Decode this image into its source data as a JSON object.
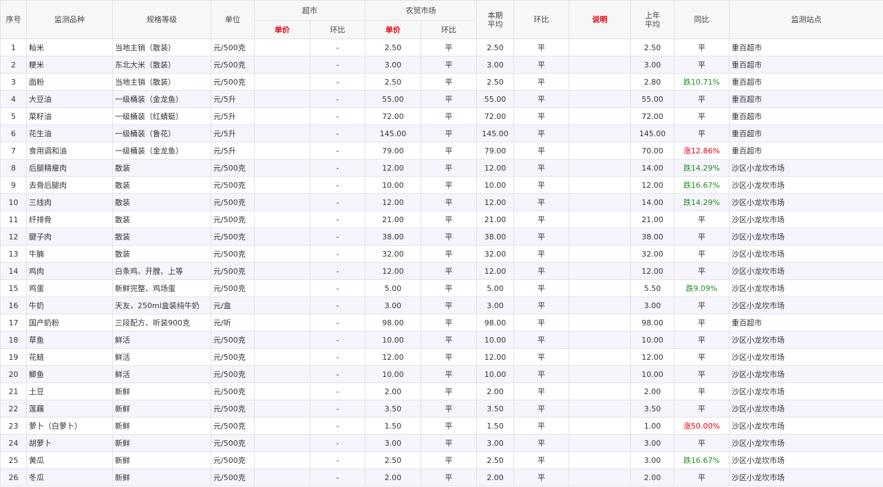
{
  "headers": {
    "seq": "序号",
    "item": "监测品种",
    "spec": "规格等级",
    "unit": "单位",
    "supermarket": "超市",
    "farmers_market": "农贸市场",
    "unit_price": "单价",
    "mom": "环比",
    "current_avg": "本期\n平均",
    "note": "说明",
    "last_year_avg": "上年\n平均",
    "yoy": "同比",
    "station": "监测站点"
  },
  "rows": [
    {
      "no": "1",
      "item": "籼米",
      "spec": "当地主销（散装）",
      "unit": "元/500克",
      "sm_price": "",
      "sm_mom": "-",
      "fm_price": "2.50",
      "fm_mom": "平",
      "avg": "2.50",
      "avg_mom": "平",
      "note": "",
      "last": "2.50",
      "yoy": "平",
      "station": "重百超市"
    },
    {
      "no": "2",
      "item": "粳米",
      "spec": "东北大米（散装）",
      "unit": "元/500克",
      "sm_price": "",
      "sm_mom": "-",
      "fm_price": "3.00",
      "fm_mom": "平",
      "avg": "3.00",
      "avg_mom": "平",
      "note": "",
      "last": "3.00",
      "yoy": "平",
      "station": "重百超市"
    },
    {
      "no": "3",
      "item": "面粉",
      "spec": "当地主销（散装）",
      "unit": "元/500克",
      "sm_price": "",
      "sm_mom": "-",
      "fm_price": "2.50",
      "fm_mom": "平",
      "avg": "2.50",
      "avg_mom": "平",
      "note": "",
      "last": "2.80",
      "yoy": "跌10.71%",
      "station": "重百超市"
    },
    {
      "no": "4",
      "item": "大豆油",
      "spec": "一级桶装（金龙鱼）",
      "unit": "元/5升",
      "sm_price": "",
      "sm_mom": "-",
      "fm_price": "55.00",
      "fm_mom": "平",
      "avg": "55.00",
      "avg_mom": "平",
      "note": "",
      "last": "55.00",
      "yoy": "平",
      "station": "重百超市"
    },
    {
      "no": "5",
      "item": "菜籽油",
      "spec": "一级桶装（红蜻蜓）",
      "unit": "元/5升",
      "sm_price": "",
      "sm_mom": "-",
      "fm_price": "72.00",
      "fm_mom": "平",
      "avg": "72.00",
      "avg_mom": "平",
      "note": "",
      "last": "72.00",
      "yoy": "平",
      "station": "重百超市"
    },
    {
      "no": "6",
      "item": "花生油",
      "spec": "一级桶装（鲁花）",
      "unit": "元/5升",
      "sm_price": "",
      "sm_mom": "-",
      "fm_price": "145.00",
      "fm_mom": "平",
      "avg": "145.00",
      "avg_mom": "平",
      "note": "",
      "last": "145.00",
      "yoy": "平",
      "station": "重百超市"
    },
    {
      "no": "7",
      "item": "食用调和油",
      "spec": "一级桶装（金龙鱼）",
      "unit": "元/5升",
      "sm_price": "",
      "sm_mom": "-",
      "fm_price": "79.00",
      "fm_mom": "平",
      "avg": "79.00",
      "avg_mom": "平",
      "note": "",
      "last": "70.00",
      "yoy": "涨12.86%",
      "station": "重百超市"
    },
    {
      "no": "8",
      "item": "后腿精瘦肉",
      "spec": "散装",
      "unit": "元/500克",
      "sm_price": "",
      "sm_mom": "-",
      "fm_price": "12.00",
      "fm_mom": "平",
      "avg": "12.00",
      "avg_mom": "平",
      "note": "",
      "last": "14.00",
      "yoy": "跌14.29%",
      "station": "沙区小龙坎市场"
    },
    {
      "no": "9",
      "item": "去骨后腿肉",
      "spec": "散装",
      "unit": "元/500克",
      "sm_price": "",
      "sm_mom": "-",
      "fm_price": "10.00",
      "fm_mom": "平",
      "avg": "10.00",
      "avg_mom": "平",
      "note": "",
      "last": "12.00",
      "yoy": "跌16.67%",
      "station": "沙区小龙坎市场"
    },
    {
      "no": "10",
      "item": "三线肉",
      "spec": "散装",
      "unit": "元/500克",
      "sm_price": "",
      "sm_mom": "-",
      "fm_price": "12.00",
      "fm_mom": "平",
      "avg": "12.00",
      "avg_mom": "平",
      "note": "",
      "last": "14.00",
      "yoy": "跌14.29%",
      "station": "沙区小龙坎市场"
    },
    {
      "no": "11",
      "item": "纤排骨",
      "spec": "散装",
      "unit": "元/500克",
      "sm_price": "",
      "sm_mom": "-",
      "fm_price": "21.00",
      "fm_mom": "平",
      "avg": "21.00",
      "avg_mom": "平",
      "note": "",
      "last": "21.00",
      "yoy": "平",
      "station": "沙区小龙坎市场"
    },
    {
      "no": "12",
      "item": "腱子肉",
      "spec": "散装",
      "unit": "元/500克",
      "sm_price": "",
      "sm_mom": "-",
      "fm_price": "38.00",
      "fm_mom": "平",
      "avg": "38.00",
      "avg_mom": "平",
      "note": "",
      "last": "38.00",
      "yoy": "平",
      "station": "沙区小龙坎市场"
    },
    {
      "no": "13",
      "item": "牛腩",
      "spec": "散装",
      "unit": "元/500克",
      "sm_price": "",
      "sm_mom": "-",
      "fm_price": "32.00",
      "fm_mom": "平",
      "avg": "32.00",
      "avg_mom": "平",
      "note": "",
      "last": "32.00",
      "yoy": "平",
      "station": "沙区小龙坎市场"
    },
    {
      "no": "14",
      "item": "鸡肉",
      "spec": "白条鸡、开膛、上等",
      "unit": "元/500克",
      "sm_price": "",
      "sm_mom": "-",
      "fm_price": "12.00",
      "fm_mom": "平",
      "avg": "12.00",
      "avg_mom": "平",
      "note": "",
      "last": "12.00",
      "yoy": "平",
      "station": "沙区小龙坎市场"
    },
    {
      "no": "15",
      "item": "鸡蛋",
      "spec": "新鲜完整、鸡场蛋",
      "unit": "元/500克",
      "sm_price": "",
      "sm_mom": "-",
      "fm_price": "5.00",
      "fm_mom": "平",
      "avg": "5.00",
      "avg_mom": "平",
      "note": "",
      "last": "5.50",
      "yoy": "跌9.09%",
      "station": "沙区小龙坎市场"
    },
    {
      "no": "16",
      "item": "牛奶",
      "spec": "天友，250ml盒装纯牛奶",
      "unit": "元/盒",
      "sm_price": "",
      "sm_mom": "-",
      "fm_price": "3.00",
      "fm_mom": "平",
      "avg": "3.00",
      "avg_mom": "平",
      "note": "",
      "last": "3.00",
      "yoy": "平",
      "station": "沙区小龙坎市场"
    },
    {
      "no": "17",
      "item": "国产奶粉",
      "spec": "三段配方、听装900克",
      "unit": "元/听",
      "sm_price": "",
      "sm_mom": "-",
      "fm_price": "98.00",
      "fm_mom": "平",
      "avg": "98.00",
      "avg_mom": "平",
      "note": "",
      "last": "98.00",
      "yoy": "平",
      "station": "重百超市"
    },
    {
      "no": "18",
      "item": "草鱼",
      "spec": "鲜活",
      "unit": "元/500克",
      "sm_price": "",
      "sm_mom": "-",
      "fm_price": "10.00",
      "fm_mom": "平",
      "avg": "10.00",
      "avg_mom": "平",
      "note": "",
      "last": "10.00",
      "yoy": "平",
      "station": "沙区小龙坎市场"
    },
    {
      "no": "19",
      "item": "花鲢",
      "spec": "鲜活",
      "unit": "元/500克",
      "sm_price": "",
      "sm_mom": "-",
      "fm_price": "12.00",
      "fm_mom": "平",
      "avg": "12.00",
      "avg_mom": "平",
      "note": "",
      "last": "12.00",
      "yoy": "平",
      "station": "沙区小龙坎市场"
    },
    {
      "no": "20",
      "item": "鲫鱼",
      "spec": "鲜活",
      "unit": "元/500克",
      "sm_price": "",
      "sm_mom": "-",
      "fm_price": "10.00",
      "fm_mom": "平",
      "avg": "10.00",
      "avg_mom": "平",
      "note": "",
      "last": "10.00",
      "yoy": "平",
      "station": "沙区小龙坎市场"
    },
    {
      "no": "21",
      "item": "土豆",
      "spec": "新鲜",
      "unit": "元/500克",
      "sm_price": "",
      "sm_mom": "-",
      "fm_price": "2.00",
      "fm_mom": "平",
      "avg": "2.00",
      "avg_mom": "平",
      "note": "",
      "last": "2.00",
      "yoy": "平",
      "station": "沙区小龙坎市场"
    },
    {
      "no": "22",
      "item": "莲藕",
      "spec": "新鲜",
      "unit": "元/500克",
      "sm_price": "",
      "sm_mom": "-",
      "fm_price": "3.50",
      "fm_mom": "平",
      "avg": "3.50",
      "avg_mom": "平",
      "note": "",
      "last": "3.50",
      "yoy": "平",
      "station": "沙区小龙坎市场"
    },
    {
      "no": "23",
      "item": "萝卜（白萝卜）",
      "spec": "新鲜",
      "unit": "元/500克",
      "sm_price": "",
      "sm_mom": "-",
      "fm_price": "1.50",
      "fm_mom": "平",
      "avg": "1.50",
      "avg_mom": "平",
      "note": "",
      "last": "1.00",
      "yoy": "涨50.00%",
      "station": "沙区小龙坎市场"
    },
    {
      "no": "24",
      "item": "胡萝卜",
      "spec": "新鲜",
      "unit": "元/500克",
      "sm_price": "",
      "sm_mom": "-",
      "fm_price": "3.00",
      "fm_mom": "平",
      "avg": "3.00",
      "avg_mom": "平",
      "note": "",
      "last": "3.00",
      "yoy": "平",
      "station": "沙区小龙坎市场"
    },
    {
      "no": "25",
      "item": "黄瓜",
      "spec": "新鲜",
      "unit": "元/500克",
      "sm_price": "",
      "sm_mom": "-",
      "fm_price": "2.50",
      "fm_mom": "平",
      "avg": "2.50",
      "avg_mom": "平",
      "note": "",
      "last": "3.00",
      "yoy": "跌16.67%",
      "station": "沙区小龙坎市场"
    },
    {
      "no": "26",
      "item": "冬瓜",
      "spec": "新鲜",
      "unit": "元/500克",
      "sm_price": "",
      "sm_mom": "-",
      "fm_price": "2.00",
      "fm_mom": "平",
      "avg": "2.00",
      "avg_mom": "平",
      "note": "",
      "last": "2.00",
      "yoy": "平",
      "station": "沙区小龙坎市场"
    }
  ]
}
